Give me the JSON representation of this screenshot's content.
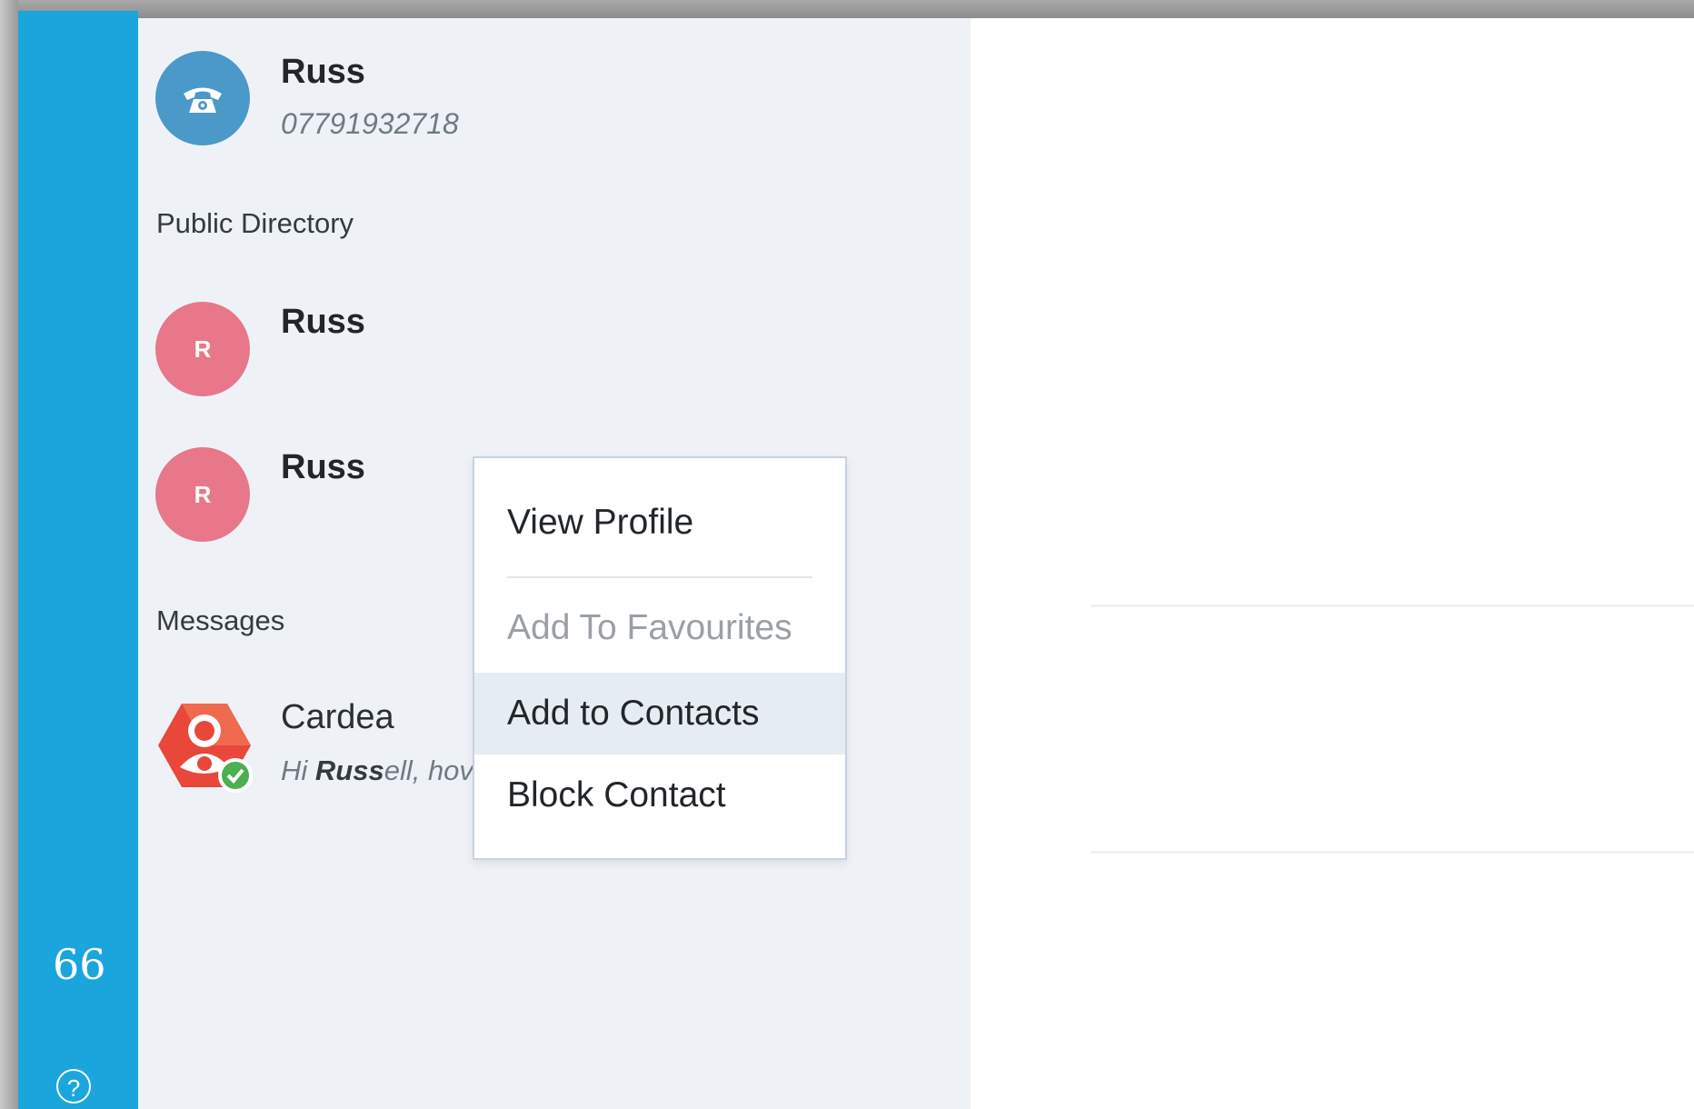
{
  "sidebar": {
    "quote_icon": "66",
    "help_icon": "?"
  },
  "top_result": {
    "name": "Russ",
    "number": "07791932718",
    "avatar_icon": "phone-icon"
  },
  "public_directory": {
    "label": "Public Directory",
    "entries": [
      {
        "name": "Russ",
        "initial": "R"
      },
      {
        "name": "Russ",
        "initial": "R"
      }
    ]
  },
  "messages": {
    "label": "Messages",
    "items": [
      {
        "name": "Cardea",
        "preview_prefix": "Hi ",
        "preview_bold": "Russ",
        "preview_suffix": "ell, hov"
      }
    ]
  },
  "context_menu": {
    "items": [
      {
        "label": "View Profile",
        "state": "normal"
      },
      {
        "label": "Add To Favourites",
        "state": "disabled"
      },
      {
        "label": "Add to Contacts",
        "state": "highlighted"
      },
      {
        "label": "Block Contact",
        "state": "normal"
      }
    ]
  },
  "colors": {
    "rail": "#1aa5dd",
    "phone_avatar": "#4a99c9",
    "initial_avatar": "#e8778a",
    "results_bg": "#eef2f6",
    "menu_highlight": "#e6edf2",
    "online_status": "#4caf50",
    "cardea_red": "#e8473a"
  }
}
